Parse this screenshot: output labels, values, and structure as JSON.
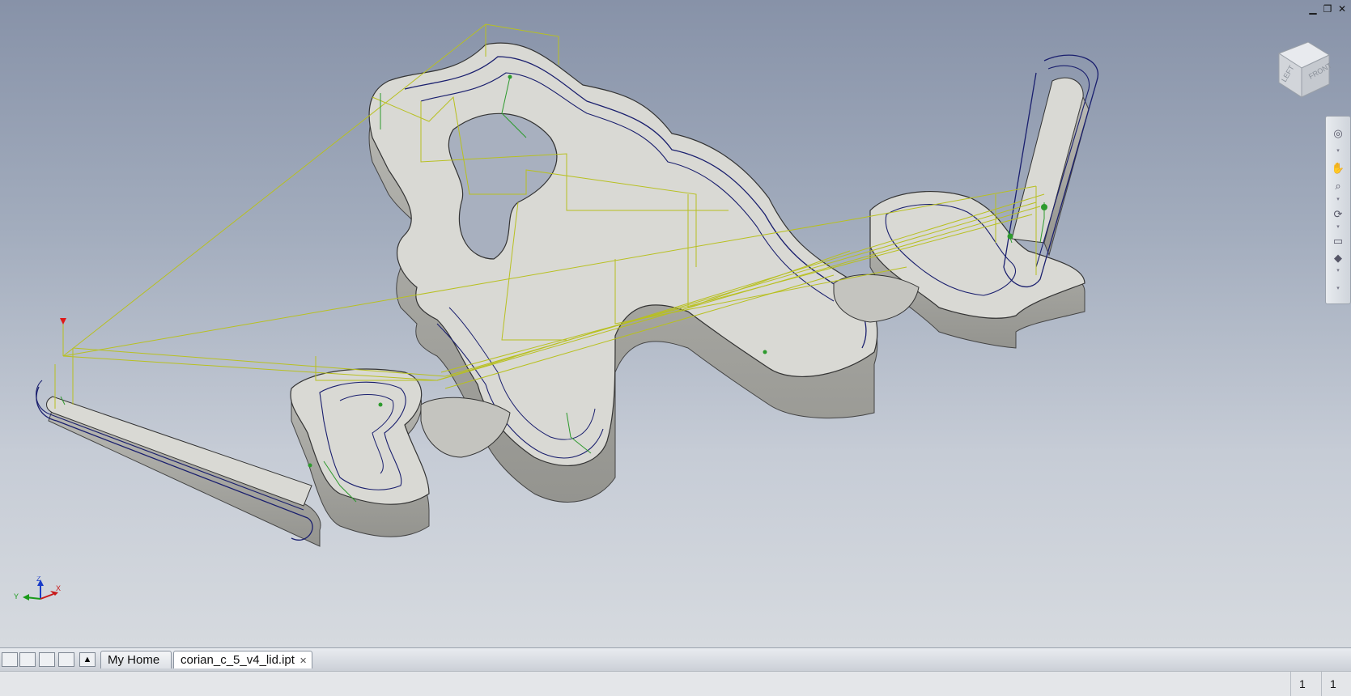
{
  "window_controls": {
    "minimize": "▁",
    "restore": "❐",
    "close": "✕"
  },
  "viewcube": {
    "faces": [
      "FRONT",
      "LEFT"
    ]
  },
  "triad": {
    "x": "X",
    "y": "Y",
    "z": "Z"
  },
  "tabs": [
    {
      "label": "My Home",
      "active": false
    },
    {
      "label": "corian_c_5_v4_lid.ipt",
      "active": true
    }
  ],
  "status": {
    "values": [
      "1",
      "1"
    ]
  },
  "colors": {
    "toolpath_yellow": "#b8c020",
    "toolpath_blue": "#1a1f6e",
    "toolpath_green": "#2d9a2d",
    "part_top": "#dcdcd8",
    "part_side": "#a9a9a4"
  },
  "icons": [
    "tile-windows-icon",
    "arrange-grid-icon",
    "horizontal-split-icon",
    "vertical-split-icon",
    "expand-up-icon",
    "steering-wheel-icon",
    "pan-icon",
    "zoom-icon",
    "orbit-icon",
    "look-at-icon",
    "view-settings-icon"
  ]
}
